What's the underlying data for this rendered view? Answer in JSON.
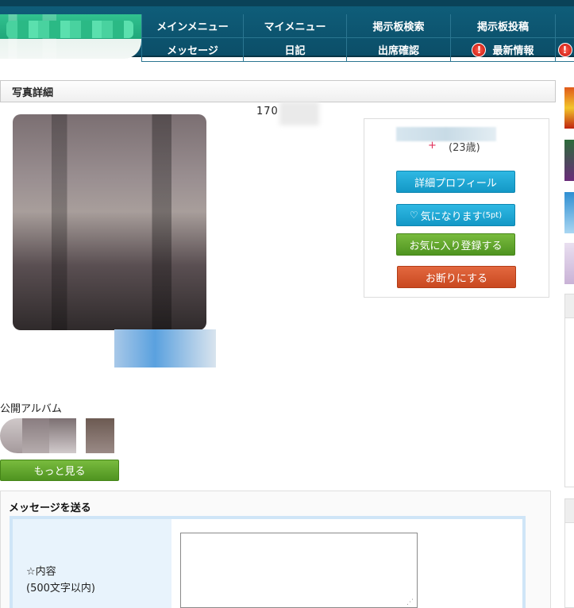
{
  "nav": {
    "row1": [
      "メインメニュー",
      "マイメニュー",
      "掲示板検索",
      "掲示板投稿"
    ],
    "row2": [
      "メッセージ",
      "日記",
      "出席確認",
      "最新情報"
    ],
    "alert_icon": "exclamation-icon"
  },
  "section": {
    "title": "写真詳細"
  },
  "photo": {
    "id_prefix": "170"
  },
  "profile": {
    "gender_symbol": "+",
    "age": "(23歳)",
    "buttons": {
      "detail_profile": "詳細プロフィール",
      "interested": "気になります",
      "interested_cost": "(5pt)",
      "favorite": "お気に入り登録する",
      "decline": "お断りにする"
    }
  },
  "album": {
    "label": "公開アルバム",
    "more_button": "もっと見る"
  },
  "message": {
    "title": "メッセージを送る",
    "content_label": "☆内容",
    "content_limit": "(500文字以内)",
    "content_value": ""
  },
  "colors": {
    "header_bg": "#0f5d79",
    "button_blue": "#1ca6d3",
    "button_green": "#5fa42b",
    "button_orange": "#d5552c",
    "form_border": "#cfe5f7"
  }
}
